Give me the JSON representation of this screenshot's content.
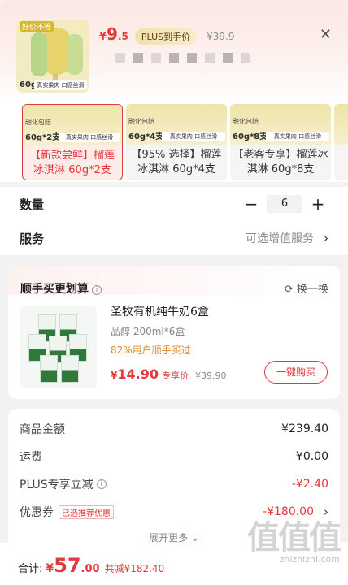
{
  "header": {
    "thumb_tag": "好价不等",
    "thumb_weight": "60g",
    "thumb_bar": "真实果肉 口感丝滑",
    "price_currency": "¥",
    "price_int": "9",
    "price_dec": ".5",
    "plus_label": "PLUS到手价",
    "orig_price": "¥39.9"
  },
  "variants": [
    {
      "weight": "60g*2支",
      "bar": "真实果肉 口感丝滑",
      "tag": "融化包赔",
      "label": "【新款尝鲜】榴莲冰淇淋 60g*2支",
      "selected": true
    },
    {
      "weight": "60g*4支",
      "bar": "真实果肉 口感丝滑",
      "tag": "融化包赔",
      "label": "【95% 选择】榴莲冰淇淋 60g*4支",
      "selected": false
    },
    {
      "weight": "60g*8支",
      "bar": "真实果肉 口感丝滑",
      "tag": "融化包赔",
      "label": "【老客专享】榴莲冰淇淋 60g*8支",
      "selected": false
    }
  ],
  "quantity": {
    "label": "数量",
    "minus": "−",
    "value": "6",
    "plus": "+"
  },
  "service": {
    "label": "服务",
    "hint": "可选增值服务",
    "chevron": "›"
  },
  "bundle": {
    "title": "顺手买更划算",
    "refresh": "⟳ 换一换",
    "name": "圣牧有机纯牛奶6盒",
    "spec": "品醇 200ml*6盒",
    "ratio": "82%用户顺手买过",
    "price_currency": "¥",
    "price": "14.90",
    "price_label": "专享价",
    "orig_price": "¥39.90",
    "button": "一键购买"
  },
  "summary": {
    "rows": [
      {
        "label": "商品金额",
        "value": "¥239.40"
      },
      {
        "label": "运费",
        "value": "¥0.00"
      },
      {
        "label": "PLUS专享立减",
        "value": "-¥2.40"
      },
      {
        "label": "优惠券",
        "value": "-¥180.00",
        "tag": "已选推荐优惠"
      }
    ],
    "expand": "展开更多 ⌄"
  },
  "bottom": {
    "label": "合计:",
    "currency": "¥",
    "int": "57",
    "dec": ".00",
    "save": "共减¥182.40"
  },
  "watermark": {
    "logo": "值值值",
    "url": "zhizhizhi.com"
  },
  "colors": {
    "accent": "#e4393c",
    "plus_gold": "#f3dfa9",
    "ratio_orange": "#d98a2b"
  }
}
